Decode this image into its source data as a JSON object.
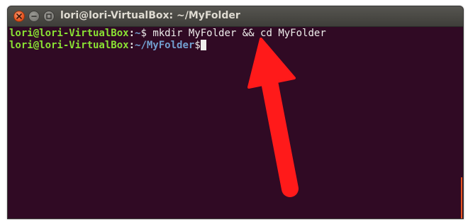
{
  "window": {
    "title": "lori@lori-VirtualBox: ~/MyFolder"
  },
  "terminal": {
    "lines": [
      {
        "user_host": "lori@lori-VirtualBox",
        "separator": ":",
        "path": "~",
        "prompt": "$",
        "command": " mkdir MyFolder && cd MyFolder"
      },
      {
        "user_host": "lori@lori-VirtualBox",
        "separator": ":",
        "path": "~/MyFolder",
        "prompt": "$",
        "command": ""
      }
    ]
  },
  "colors": {
    "terminal_background": "#300a24",
    "prompt_user": "#8ae234",
    "prompt_path": "#729fcf",
    "close_button": "#e95420",
    "annotation_arrow": "#ff1a1a"
  },
  "icons": {
    "close": "close-icon",
    "minimize": "minimize-icon",
    "maximize": "maximize-icon",
    "annotation": "red-arrow-icon"
  }
}
